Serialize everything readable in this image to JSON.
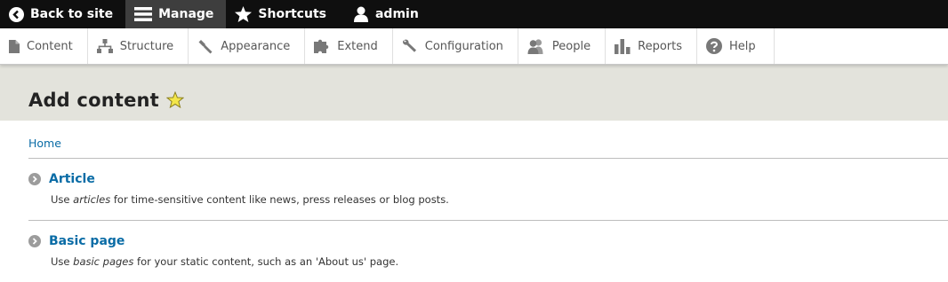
{
  "toolbar": {
    "back": "Back to site",
    "manage": "Manage",
    "shortcuts": "Shortcuts",
    "user": "admin"
  },
  "tray": {
    "items": [
      {
        "label": "Content",
        "icon": "file-icon"
      },
      {
        "label": "Structure",
        "icon": "structure-icon"
      },
      {
        "label": "Appearance",
        "icon": "paintbrush-icon"
      },
      {
        "label": "Extend",
        "icon": "puzzle-icon"
      },
      {
        "label": "Configuration",
        "icon": "wrench-icon"
      },
      {
        "label": "People",
        "icon": "people-icon"
      },
      {
        "label": "Reports",
        "icon": "bar-chart-icon"
      },
      {
        "label": "Help",
        "icon": "question-icon"
      }
    ]
  },
  "page": {
    "title": "Add content",
    "star_color": "#f3e64a"
  },
  "breadcrumb": {
    "home": "Home"
  },
  "content_types": [
    {
      "name": "Article",
      "desc_pre": "Use ",
      "desc_em": "articles",
      "desc_post": " for time-sensitive content like news, press releases or blog posts."
    },
    {
      "name": "Basic page",
      "desc_pre": "Use ",
      "desc_em": "basic pages",
      "desc_post": " for your static content, such as an 'About us' page."
    }
  ]
}
